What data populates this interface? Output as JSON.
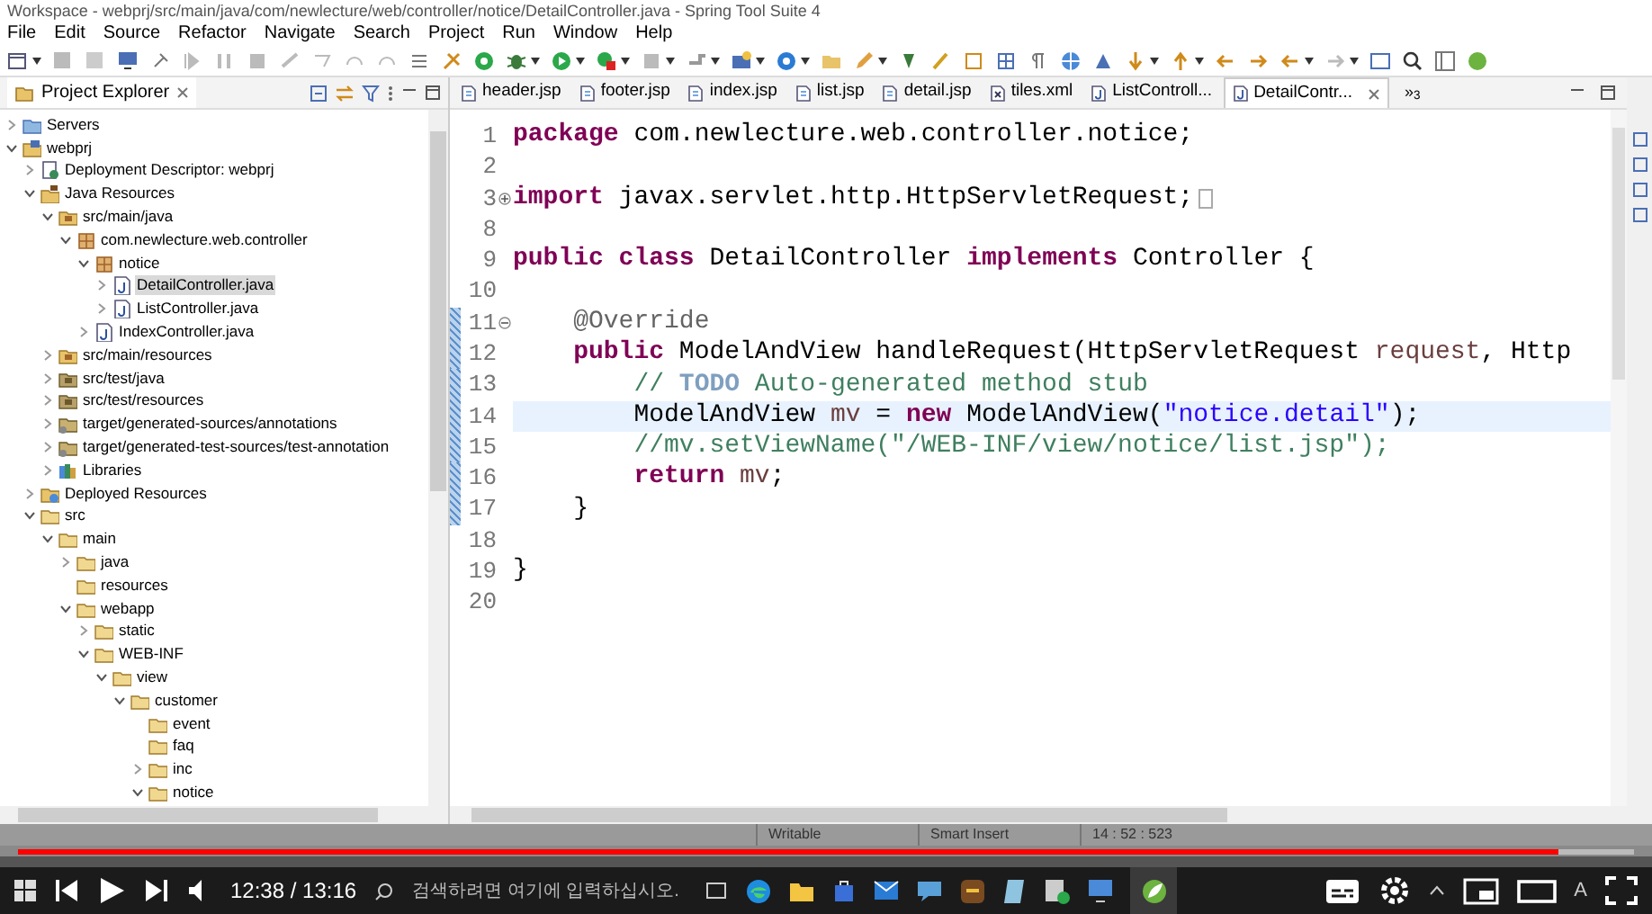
{
  "window": {
    "title": "Workspace - webprj/src/main/java/com/newlecture/web/controller/notice/DetailController.java - Spring Tool Suite 4"
  },
  "menu": [
    "File",
    "Edit",
    "Source",
    "Refactor",
    "Navigate",
    "Search",
    "Project",
    "Run",
    "Window",
    "Help"
  ],
  "explorer": {
    "title": "Project Explorer",
    "tree": [
      {
        "label": "Servers",
        "kind": "servers",
        "expanded": false,
        "selected": false
      },
      {
        "label": "webprj",
        "kind": "project",
        "expanded": true,
        "selected": false,
        "children": [
          {
            "label": "Deployment Descriptor: webprj",
            "kind": "descriptor",
            "expanded": false,
            "selected": false
          },
          {
            "label": "Java Resources",
            "kind": "java-resources",
            "expanded": true,
            "selected": false,
            "children": [
              {
                "label": "src/main/java",
                "kind": "source-folder",
                "expanded": true,
                "selected": false,
                "children": [
                  {
                    "label": "com.newlecture.web.controller",
                    "kind": "package",
                    "expanded": true,
                    "selected": false,
                    "children": [
                      {
                        "label": "notice",
                        "kind": "package",
                        "expanded": true,
                        "selected": false,
                        "children": [
                          {
                            "label": "DetailController.java",
                            "kind": "java-file",
                            "expanded": false,
                            "selected": true
                          },
                          {
                            "label": "ListController.java",
                            "kind": "java-file",
                            "expanded": false,
                            "selected": false
                          }
                        ]
                      },
                      {
                        "label": "IndexController.java",
                        "kind": "java-file",
                        "expanded": false,
                        "selected": false
                      }
                    ]
                  }
                ]
              },
              {
                "label": "src/main/resources",
                "kind": "source-folder",
                "expanded": false,
                "selected": false
              },
              {
                "label": "src/test/java",
                "kind": "test-folder",
                "expanded": false,
                "selected": false
              },
              {
                "label": "src/test/resources",
                "kind": "test-folder",
                "expanded": false,
                "selected": false
              },
              {
                "label": "target/generated-sources/annotations",
                "kind": "generated-folder",
                "expanded": false,
                "selected": false
              },
              {
                "label": "target/generated-test-sources/test-annotation",
                "kind": "generated-folder",
                "expanded": false,
                "selected": false
              },
              {
                "label": "Libraries",
                "kind": "library",
                "expanded": false,
                "selected": false
              }
            ]
          },
          {
            "label": "Deployed Resources",
            "kind": "deployed",
            "expanded": false,
            "selected": false
          },
          {
            "label": "src",
            "kind": "folder",
            "expanded": true,
            "selected": false,
            "children": [
              {
                "label": "main",
                "kind": "folder",
                "expanded": true,
                "selected": false,
                "children": [
                  {
                    "label": "java",
                    "kind": "folder",
                    "expanded": false,
                    "selected": false
                  },
                  {
                    "label": "resources",
                    "kind": "folder",
                    "selected": false
                  },
                  {
                    "label": "webapp",
                    "kind": "folder",
                    "expanded": true,
                    "selected": false,
                    "children": [
                      {
                        "label": "static",
                        "kind": "folder",
                        "expanded": false,
                        "selected": false
                      },
                      {
                        "label": "WEB-INF",
                        "kind": "folder",
                        "expanded": true,
                        "selected": false,
                        "children": [
                          {
                            "label": "view",
                            "kind": "folder",
                            "expanded": true,
                            "selected": false,
                            "children": [
                              {
                                "label": "customer",
                                "kind": "folder",
                                "expanded": true,
                                "selected": false,
                                "children": [
                                  {
                                    "label": "event",
                                    "kind": "folder",
                                    "selected": false
                                  },
                                  {
                                    "label": "faq",
                                    "kind": "folder",
                                    "selected": false
                                  },
                                  {
                                    "label": "inc",
                                    "kind": "folder",
                                    "expanded": false,
                                    "selected": false
                                  },
                                  {
                                    "label": "notice",
                                    "kind": "folder",
                                    "expanded": true,
                                    "selected": false
                                  }
                                ]
                              }
                            ]
                          }
                        ]
                      }
                    ]
                  }
                ]
              }
            ]
          }
        ]
      }
    ]
  },
  "editor": {
    "tabs": [
      {
        "label": "header.jsp",
        "kind": "jsp",
        "selected": false
      },
      {
        "label": "footer.jsp",
        "kind": "jsp",
        "selected": false
      },
      {
        "label": "index.jsp",
        "kind": "jsp",
        "selected": false
      },
      {
        "label": "list.jsp",
        "kind": "jsp",
        "selected": false
      },
      {
        "label": "detail.jsp",
        "kind": "jsp",
        "selected": false
      },
      {
        "label": "tiles.xml",
        "kind": "xml",
        "selected": false
      },
      {
        "label": "ListControll...",
        "kind": "java",
        "selected": false
      },
      {
        "label": "DetailContr...",
        "kind": "java",
        "selected": true
      }
    ],
    "overflow": "»$_{3}$",
    "lines": [
      {
        "number": "1",
        "highlighted": false,
        "changed": false,
        "tokens": [
          {
            "kind": "keyword",
            "text": "package"
          },
          {
            "kind": "plain",
            "text": " com.newlecture.web.controller.notice;"
          }
        ]
      },
      {
        "number": "2",
        "highlighted": false,
        "changed": false
      },
      {
        "number": "3",
        "highlighted": false,
        "changed": false,
        "folded": true,
        "tokens": [
          {
            "kind": "keyword",
            "text": "import"
          },
          {
            "kind": "plain",
            "text": " javax.servlet.http.HttpServletRequest;"
          }
        ]
      },
      {
        "number": "8",
        "highlighted": false,
        "changed": false
      },
      {
        "number": "9",
        "highlighted": false,
        "changed": false,
        "tokens": [
          {
            "kind": "keyword",
            "text": "public class"
          },
          {
            "kind": "plain",
            "text": " DetailController "
          },
          {
            "kind": "keyword",
            "text": "implements"
          },
          {
            "kind": "plain",
            "text": " Controller {"
          }
        ]
      },
      {
        "number": "10",
        "highlighted": false,
        "changed": false
      },
      {
        "number": "11",
        "highlighted": false,
        "changed": true,
        "folded": false,
        "tokens": [
          {
            "kind": "annotation",
            "text": "    @Override"
          }
        ]
      },
      {
        "number": "12",
        "highlighted": false,
        "changed": true,
        "tokens": [
          {
            "kind": "keyword",
            "text": "    public"
          },
          {
            "kind": "plain",
            "text": " ModelAndView handleRequest(HttpServletRequest "
          },
          {
            "kind": "variable",
            "text": "request"
          },
          {
            "kind": "plain",
            "text": ", Http"
          }
        ]
      },
      {
        "number": "13",
        "highlighted": false,
        "changed": true,
        "tokens": [
          {
            "kind": "comment",
            "text": "        // "
          },
          {
            "kind": "todo",
            "text": "TODO"
          },
          {
            "kind": "comment",
            "text": " Auto-generated method stub"
          }
        ]
      },
      {
        "number": "14",
        "highlighted": true,
        "changed": true,
        "tokens": [
          {
            "kind": "plain",
            "text": "        ModelAndView "
          },
          {
            "kind": "variable",
            "text": "mv"
          },
          {
            "kind": "plain",
            "text": " = "
          },
          {
            "kind": "keyword",
            "text": "new"
          },
          {
            "kind": "plain",
            "text": " ModelAndView("
          },
          {
            "kind": "string",
            "text": "\"notice.detail\""
          },
          {
            "kind": "plain",
            "text": ");"
          }
        ]
      },
      {
        "number": "15",
        "highlighted": false,
        "changed": true,
        "tokens": [
          {
            "kind": "comment",
            "text": "        //mv.setViewName(\"/WEB-INF/view/notice/list.jsp\");"
          }
        ]
      },
      {
        "number": "16",
        "highlighted": false,
        "changed": true,
        "tokens": [
          {
            "kind": "keyword",
            "text": "        return"
          },
          {
            "kind": "variable",
            "text": " mv"
          },
          {
            "kind": "plain",
            "text": ";"
          }
        ]
      },
      {
        "number": "17",
        "highlighted": false,
        "changed": true,
        "tokens": [
          {
            "kind": "plain",
            "text": "    }"
          }
        ]
      },
      {
        "number": "18",
        "highlighted": false,
        "changed": false
      },
      {
        "number": "19",
        "highlighted": false,
        "changed": false,
        "tokens": [
          {
            "kind": "plain",
            "text": "}"
          }
        ]
      },
      {
        "number": "20",
        "highlighted": false,
        "changed": false
      }
    ]
  },
  "status_bar": [
    "Writable",
    "Smart Insert",
    "14 : 52 : 523"
  ],
  "video_player": {
    "progress": {
      "level": 0.953
    },
    "time": "12:38 / 13:16"
  },
  "taskbar": {
    "search_placeholder": "검색하려면 여기에 입력하십시오.",
    "tray_text": "A"
  }
}
